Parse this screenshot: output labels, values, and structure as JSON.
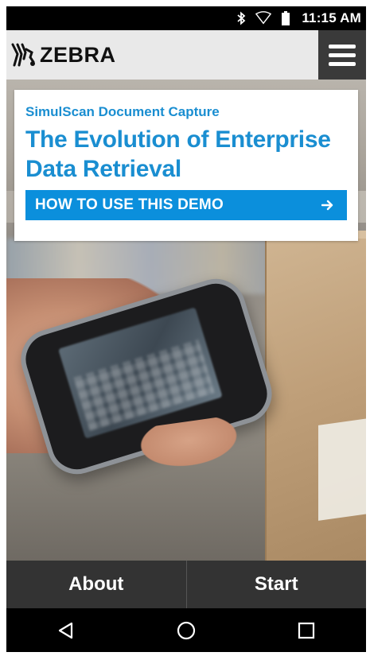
{
  "status_bar": {
    "time": "11:15 AM",
    "icons": [
      "bluetooth-icon",
      "wifi-icon",
      "battery-icon"
    ]
  },
  "header": {
    "logo_text": "ZEBRA",
    "menu_icon": "hamburger-menu-icon"
  },
  "card": {
    "subtitle": "SimulScan Document Capture",
    "title": "The Evolution of Enterprise Data Retrieval",
    "demo_button_label": "HOW TO USE THIS DEMO",
    "demo_button_icon": "arrow-right-icon"
  },
  "hero": {
    "image": "hand-holding-symbol-mobile-computer-photo"
  },
  "bottom_buttons": {
    "about": "About",
    "start": "Start"
  },
  "nav_bar": {
    "icons": [
      "back-icon",
      "home-icon",
      "recents-icon"
    ]
  },
  "colors": {
    "accent": "#0b8fdc",
    "title_blue": "#1a8ed1",
    "bottom_bar": "#333333",
    "header_bg": "#e9e9e9"
  }
}
